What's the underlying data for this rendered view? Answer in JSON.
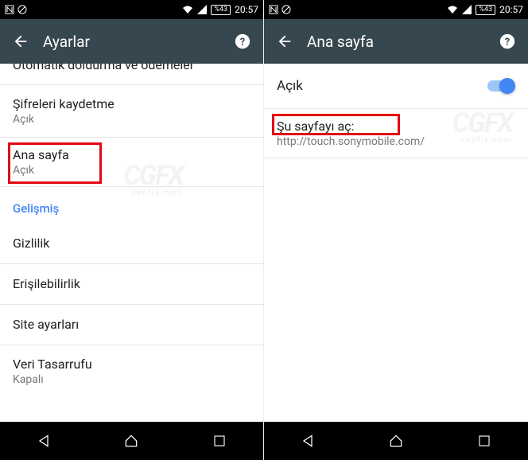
{
  "status": {
    "battery": "%43",
    "time": "20:57"
  },
  "left": {
    "appbar_title": "Ayarlar",
    "cutoff_item": "Otomatik doldurma ve ödemeler",
    "items": {
      "sifreleri": {
        "title": "Şifreleri kaydetme",
        "sub": "Açık"
      },
      "ana": {
        "title": "Ana sayfa",
        "sub": "Açık"
      },
      "gelismis": "Gelişmiş",
      "gizlilik": "Gizlilik",
      "erisilebilirlik": "Erişilebilirlik",
      "site": "Site ayarları",
      "veri": {
        "title": "Veri Tasarrufu",
        "sub": "Kapalı"
      }
    }
  },
  "right": {
    "appbar_title": "Ana sayfa",
    "toggle_label": "Açık",
    "open_page": {
      "title": "Şu sayfayı aç:",
      "url": "http://touch.sonymobile.com/"
    }
  },
  "watermark": {
    "brand": "GFX",
    "sub": "ceofix.com"
  }
}
